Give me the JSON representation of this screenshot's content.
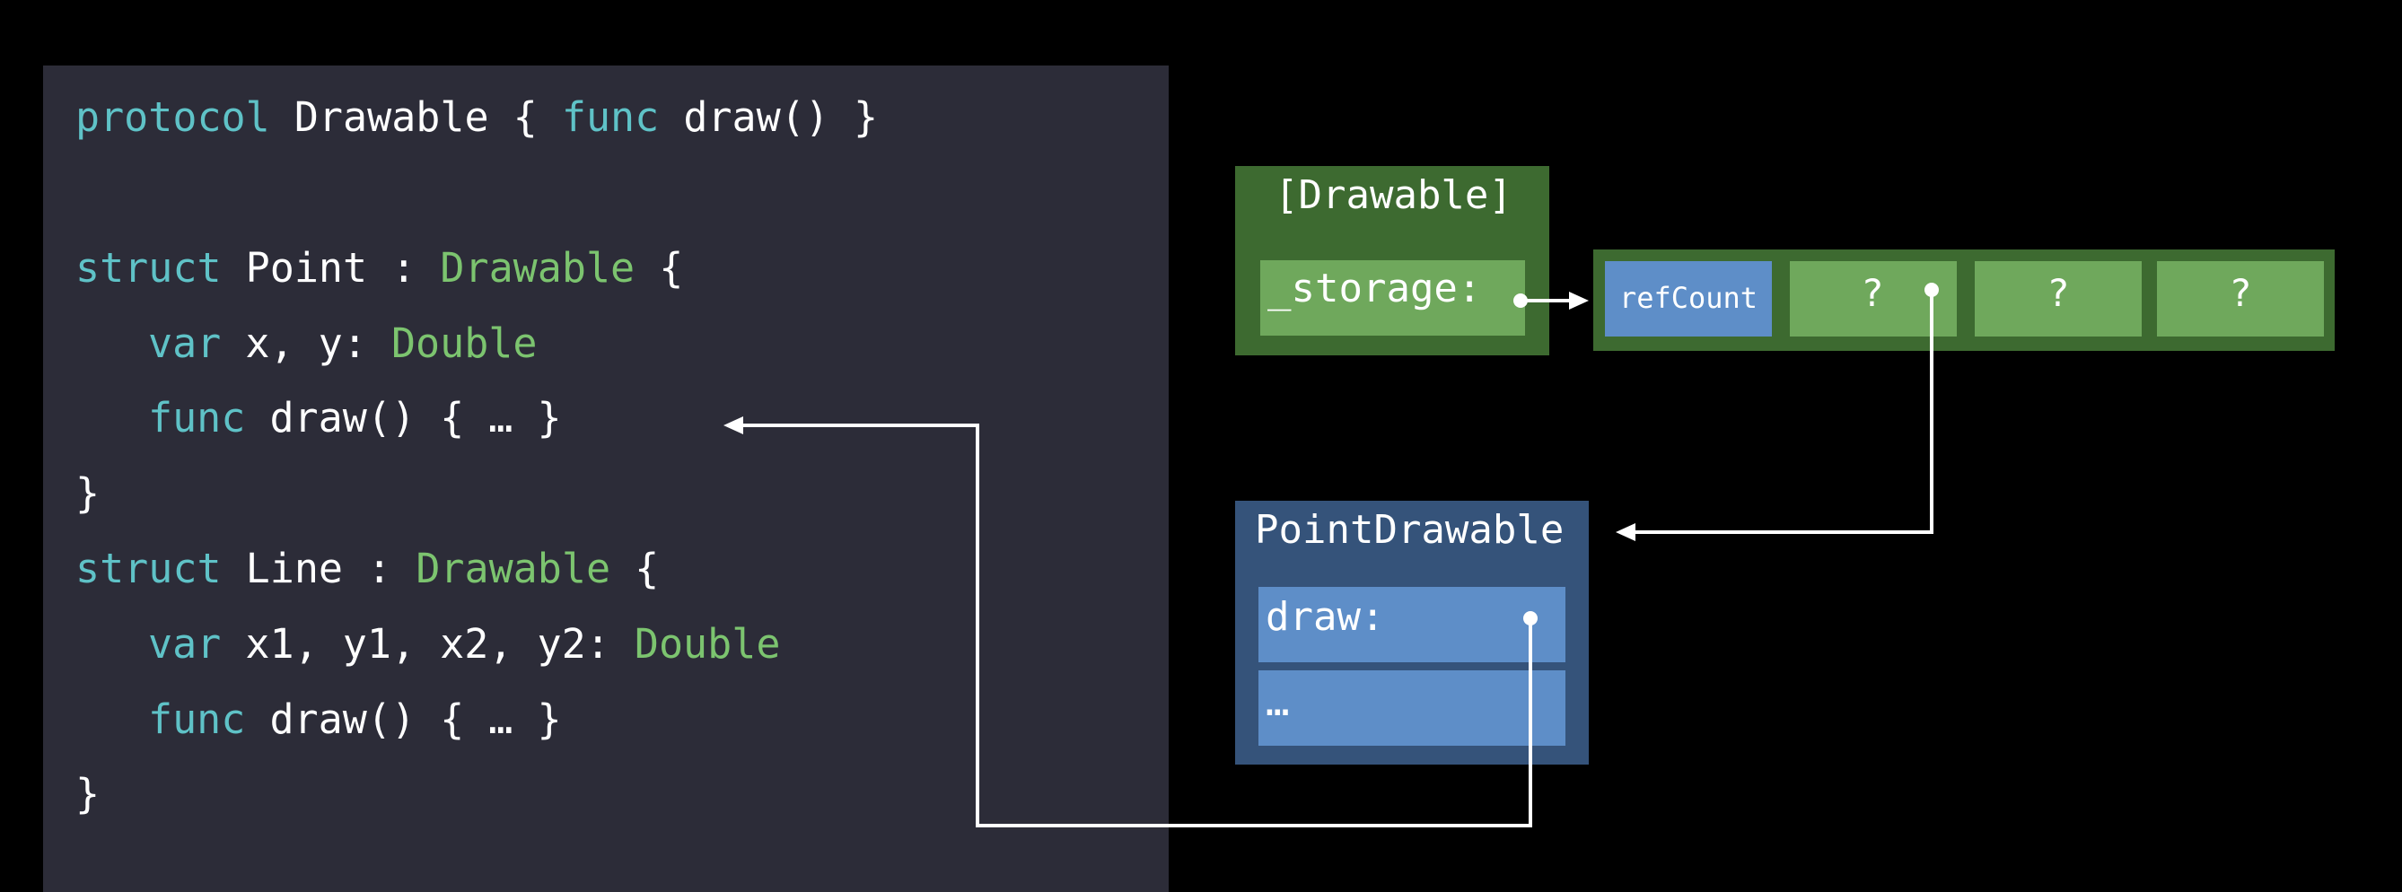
{
  "code": {
    "lines": [
      {
        "tokens": [
          {
            "t": "protocol",
            "c": "kw"
          },
          {
            "t": " Drawable { ",
            "c": ""
          },
          {
            "t": "func",
            "c": "kw"
          },
          {
            "t": " draw() }",
            "c": ""
          }
        ]
      },
      {
        "tokens": [
          {
            "t": "struct",
            "c": "kw"
          },
          {
            "t": " Point : ",
            "c": ""
          },
          {
            "t": "Drawable",
            "c": "ty"
          },
          {
            "t": " {",
            "c": ""
          }
        ]
      },
      {
        "tokens": [
          {
            "t": "var",
            "c": "kw"
          },
          {
            "t": " x, y: ",
            "c": ""
          },
          {
            "t": "Double",
            "c": "ty"
          }
        ]
      },
      {
        "tokens": [
          {
            "t": "func",
            "c": "kw"
          },
          {
            "t": " draw() { … }",
            "c": ""
          }
        ]
      },
      {
        "tokens": [
          {
            "t": "}",
            "c": ""
          }
        ]
      },
      {
        "tokens": [
          {
            "t": "struct",
            "c": "kw"
          },
          {
            "t": " Line : ",
            "c": ""
          },
          {
            "t": "Drawable",
            "c": "ty"
          },
          {
            "t": " {",
            "c": ""
          }
        ]
      },
      {
        "tokens": [
          {
            "t": "var",
            "c": "kw"
          },
          {
            "t": " x1, y1, x2, y2: ",
            "c": ""
          },
          {
            "t": "Double",
            "c": "ty"
          }
        ]
      },
      {
        "tokens": [
          {
            "t": "func",
            "c": "kw"
          },
          {
            "t": " draw() { … }",
            "c": ""
          }
        ]
      },
      {
        "tokens": [
          {
            "t": "}",
            "c": ""
          }
        ]
      }
    ]
  },
  "diagram": {
    "array_box": {
      "title": "[Drawable]",
      "storage_label": "_storage:"
    },
    "storage_cells": {
      "refcount": "refCount",
      "q1": "?",
      "q2": "?",
      "q3": "?"
    },
    "witness_table": {
      "title": "PointDrawable",
      "draw_label": "draw:",
      "more_label": "…"
    }
  },
  "colors": {
    "code_bg": "#2c2c38",
    "keyword": "#5fc2c7",
    "type": "#7cc46f",
    "green_dark": "#3d6a30",
    "green_light": "#6fa85c",
    "blue_dark": "#35537a",
    "blue_light": "#5e8ec8"
  }
}
